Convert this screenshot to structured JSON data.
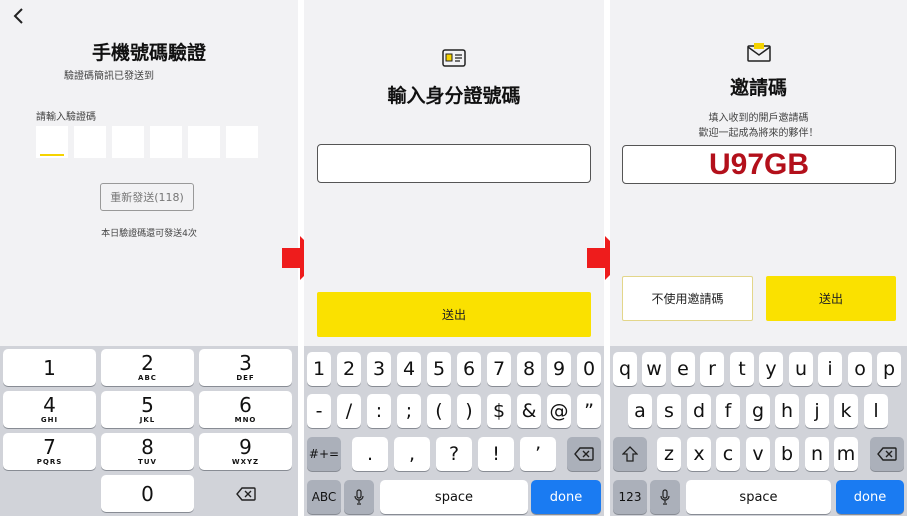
{
  "screen1": {
    "back_icon": "chevron-left-icon",
    "title": "手機號碼驗證",
    "subtitle": "驗證碼簡訊已發送到",
    "code_label": "請輸入驗證碼",
    "resend_label": "重新發送(118)",
    "remaining_note": "本日驗證碼還可發送4次",
    "keypad": [
      {
        "num": "1",
        "letters": ""
      },
      {
        "num": "2",
        "letters": "ABC"
      },
      {
        "num": "3",
        "letters": "DEF"
      },
      {
        "num": "4",
        "letters": "GHI"
      },
      {
        "num": "5",
        "letters": "JKL"
      },
      {
        "num": "6",
        "letters": "MNO"
      },
      {
        "num": "7",
        "letters": "PQRS"
      },
      {
        "num": "8",
        "letters": "TUV"
      },
      {
        "num": "9",
        "letters": "WXYZ"
      },
      {
        "num": "0",
        "letters": ""
      }
    ],
    "delete_icon": "delete-icon"
  },
  "screen2": {
    "id_icon": "id-card-icon",
    "title": "輸入身分證號碼",
    "id_input_value": "",
    "submit_label": "送出",
    "keyboard": {
      "row1": [
        "1",
        "2",
        "3",
        "4",
        "5",
        "6",
        "7",
        "8",
        "9",
        "0"
      ],
      "row2": [
        "-",
        "/",
        ":",
        ";",
        "(",
        ")",
        "$",
        "&",
        "@",
        "”"
      ],
      "symbols_toggle": "#+=",
      "row3": [
        ".",
        ",",
        "?",
        "!",
        "’"
      ],
      "abc_label": "ABC",
      "space_label": "space",
      "done_label": "done"
    }
  },
  "screen3": {
    "envelope_icon": "envelope-icon",
    "title": "邀請碼",
    "subtitle_line1": "填入收到的開戶邀請碼",
    "subtitle_line2": "歡迎一起成為將來的夥伴！",
    "invite_code": "U97GB",
    "skip_label": "不使用邀請碼",
    "submit_label": "送出",
    "keyboard": {
      "row1": [
        "q",
        "w",
        "e",
        "r",
        "t",
        "y",
        "u",
        "i",
        "o",
        "p"
      ],
      "row2": [
        "a",
        "s",
        "d",
        "f",
        "g",
        "h",
        "j",
        "k",
        "l"
      ],
      "row3": [
        "z",
        "x",
        "c",
        "v",
        "b",
        "n",
        "m"
      ],
      "num_label": "123",
      "space_label": "space",
      "done_label": "done"
    }
  },
  "colors": {
    "accent": "#fae100",
    "arrow": "#ee1c1c",
    "invite_code": "#b3101b",
    "done": "#1a7bf2"
  }
}
